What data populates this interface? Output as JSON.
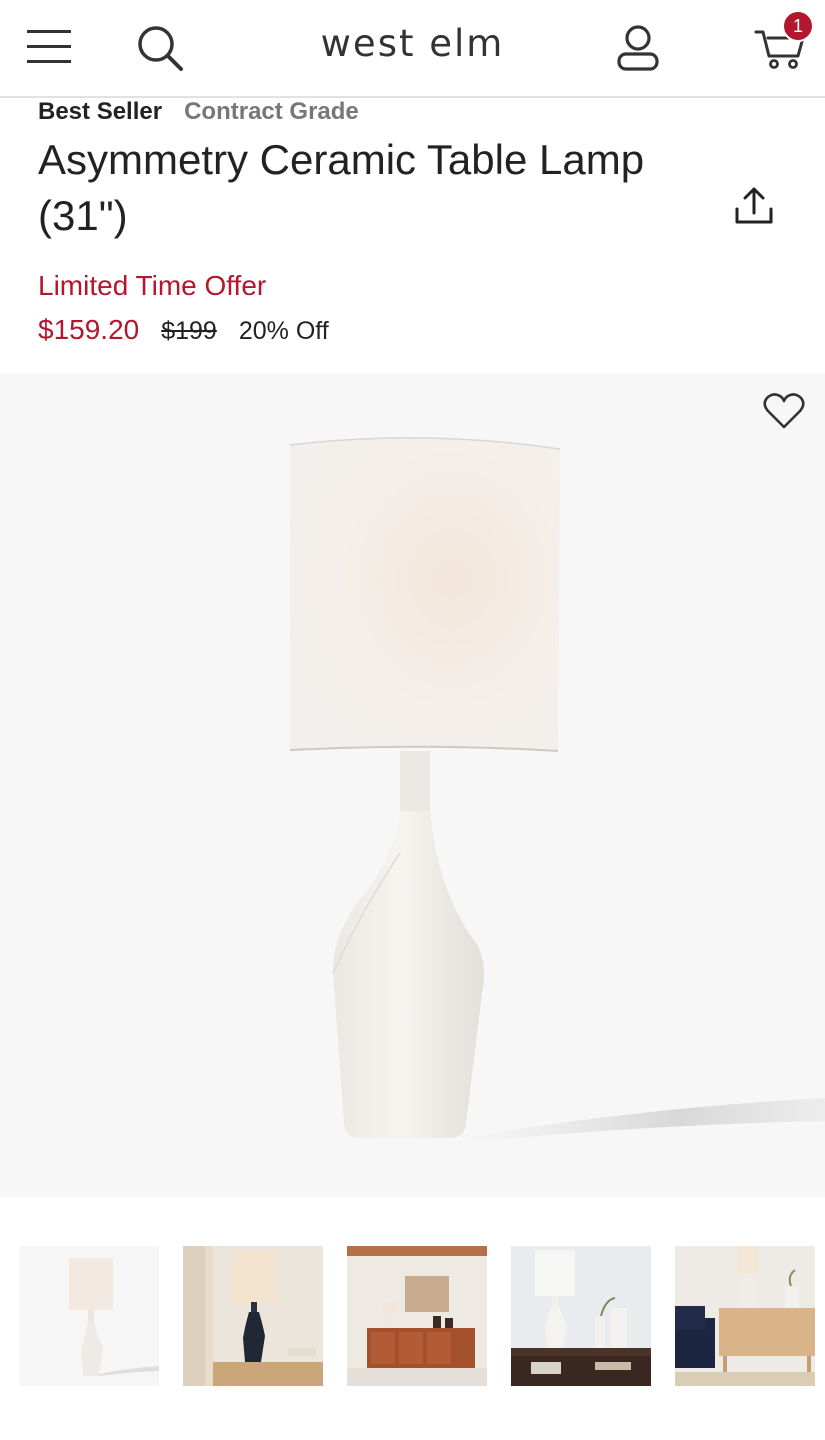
{
  "header": {
    "logo": "west elm",
    "menu_icon": "hamburger-menu-icon",
    "search_icon": "search-icon",
    "account_icon": "user-account-icon",
    "cart_icon": "shopping-cart-icon",
    "cart_count": "1"
  },
  "product": {
    "badges": [
      "Best Seller",
      "Contract Grade"
    ],
    "title": "Asymmetry Ceramic Table Lamp (31\")",
    "share_icon": "share-upload-icon",
    "offer_label": "Limited Time Offer",
    "sale_price": "$159.20",
    "original_price": "$199",
    "discount": "20% Off",
    "favorite_icon": "heart-icon"
  },
  "gallery": {
    "thumbnail_count": 5,
    "selected_index": 0
  },
  "colors": {
    "accent_red": "#b3172e",
    "text_dark": "#222222",
    "badge_gray": "#777777"
  }
}
